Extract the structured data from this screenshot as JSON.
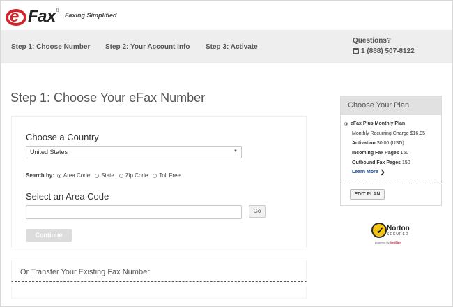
{
  "header": {
    "logo_text": "Fax",
    "logo_mark": "e",
    "logo_reg": "®",
    "tagline": "Faxing Simplified"
  },
  "steps": [
    {
      "label": "Step 1: Choose Number"
    },
    {
      "label": "Step 2: Your Account Info"
    },
    {
      "label": "Step 3: Activate"
    }
  ],
  "contact": {
    "questions_label": "Questions?",
    "phone_icon": "phone-icon",
    "phone_number": "1 (888) 507-8122"
  },
  "main": {
    "title": "Step 1: Choose Your eFax Number",
    "country_section_label": "Choose a Country",
    "country_selected": "United States",
    "search_by_label": "Search by:",
    "search_options": [
      {
        "label": "Area Code",
        "checked": true
      },
      {
        "label": "State",
        "checked": false
      },
      {
        "label": "Zip Code",
        "checked": false
      },
      {
        "label": "Toll Free",
        "checked": false
      }
    ],
    "area_section_label": "Select an Area Code",
    "area_input_value": "",
    "go_label": "Go",
    "continue_label": "Continue",
    "transfer_label": "Or Transfer Your Existing Fax Number"
  },
  "plan": {
    "header": "Choose Your Plan",
    "plan_name": "eFax Plus Monthly Plan",
    "recurring_charge": "Monthly Recurring Charge $16.95",
    "activation_label": "Activation",
    "activation_value": "$0.00 (USD)",
    "incoming_label": "Incoming Fax Pages",
    "incoming_value": "150",
    "outbound_label": "Outbound Fax Pages",
    "outbound_value": "150",
    "learn_more": "Learn More",
    "edit_plan": "EDIT PLAN"
  },
  "badge": {
    "brand": "Norton",
    "secured": "SECURED",
    "powered_prefix": "powered by",
    "powered_brand": "VeriSign"
  },
  "colors": {
    "brand_red": "#d1232a",
    "link_blue": "#1a4d8f",
    "bar_gray": "#eeeeee",
    "badge_yellow": "#f5c516"
  }
}
